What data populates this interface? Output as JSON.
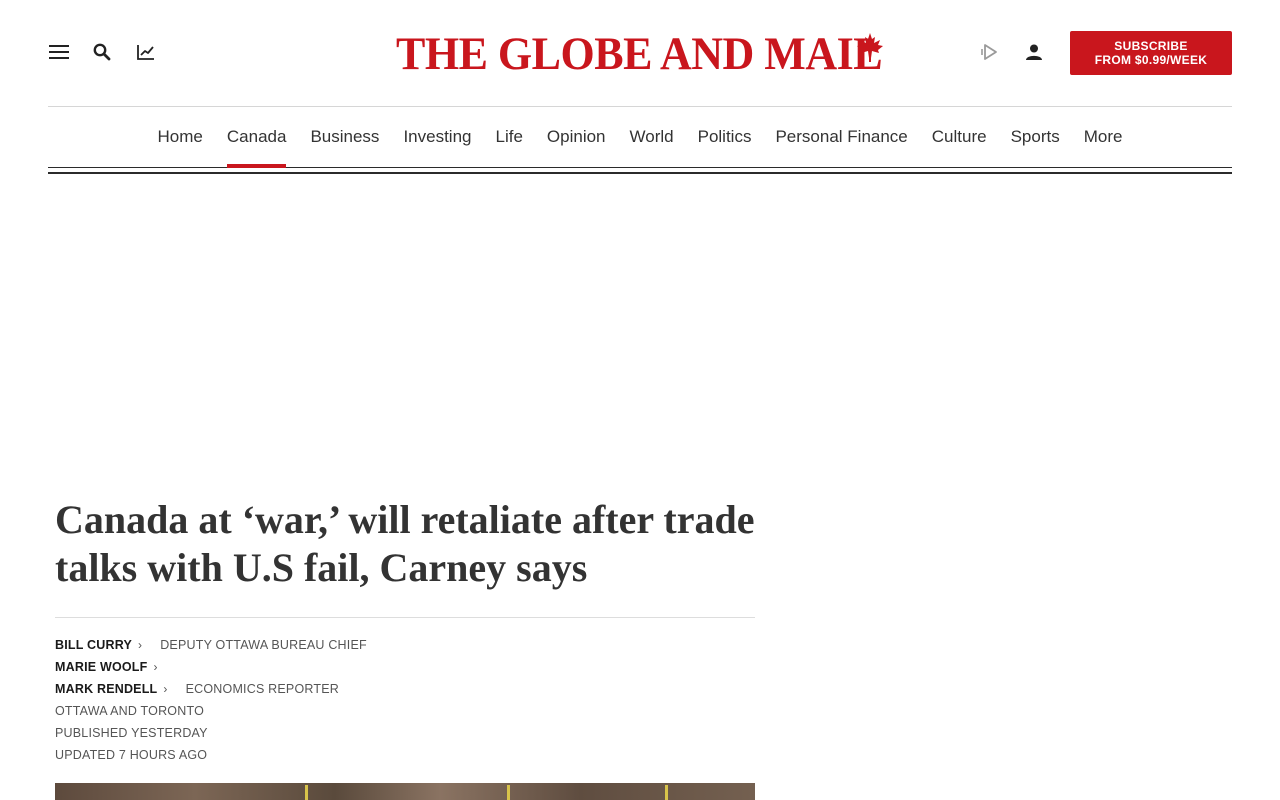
{
  "header": {
    "logo_text": "THE GLOBE AND MAIL",
    "subscribe_line1": "SUBSCRIBE",
    "subscribe_line2": "FROM $0.99/WEEK",
    "brand_color": "#c9161d",
    "icons": [
      "menu-icon",
      "search-icon",
      "chart-icon",
      "listen-icon",
      "user-icon",
      "maple-leaf-icon"
    ]
  },
  "nav": {
    "items": [
      {
        "label": "Home"
      },
      {
        "label": "Canada",
        "active": true
      },
      {
        "label": "Business"
      },
      {
        "label": "Investing"
      },
      {
        "label": "Life"
      },
      {
        "label": "Opinion"
      },
      {
        "label": "World"
      },
      {
        "label": "Politics"
      },
      {
        "label": "Personal Finance"
      },
      {
        "label": "Culture"
      },
      {
        "label": "Sports"
      },
      {
        "label": "More"
      }
    ]
  },
  "article": {
    "headline": "Canada at ‘war,’ will retaliate after trade talks with U.S fail, Carney says",
    "authors": [
      {
        "name": "BILL CURRY",
        "role": "DEPUTY OTTAWA BUREAU CHIEF"
      },
      {
        "name": "MARIE WOOLF",
        "role": ""
      },
      {
        "name": "MARK RENDELL",
        "role": "ECONOMICS REPORTER"
      }
    ],
    "location": "OTTAWA AND TORONTO",
    "published": "PUBLISHED YESTERDAY",
    "updated": "UPDATED 7 HOURS AGO"
  }
}
